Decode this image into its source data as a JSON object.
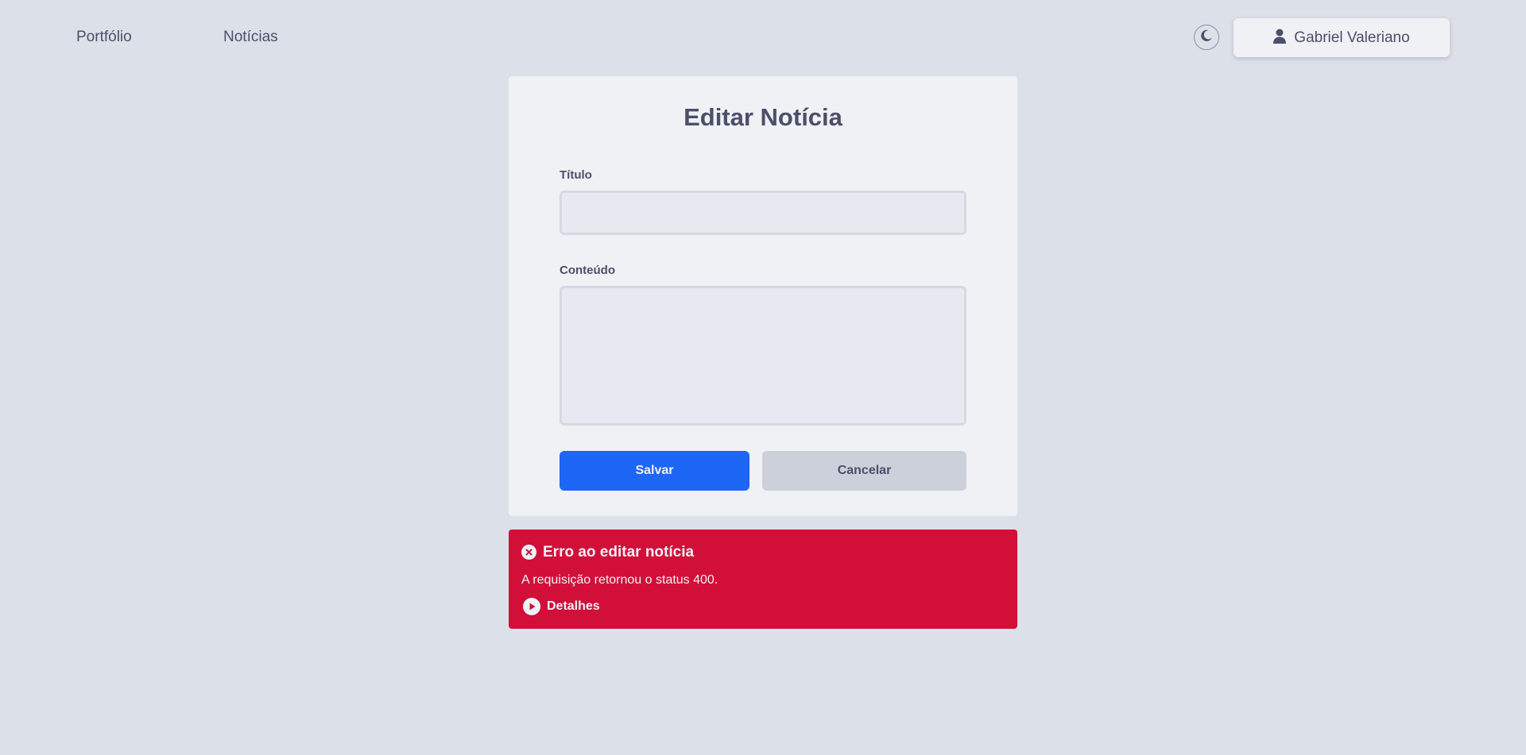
{
  "nav": {
    "links": [
      {
        "label": "Portfólio"
      },
      {
        "label": "Notícias"
      }
    ],
    "theme_toggle_icon": "moon-icon",
    "user": {
      "icon": "user-icon",
      "name": "Gabriel Valeriano"
    }
  },
  "form": {
    "title": "Editar Notícia",
    "fields": {
      "titulo": {
        "label": "Título",
        "value": "",
        "placeholder": ""
      },
      "conteudo": {
        "label": "Conteúdo",
        "value": "",
        "placeholder": ""
      }
    },
    "buttons": {
      "save_label": "Salvar",
      "cancel_label": "Cancelar"
    }
  },
  "alert": {
    "icon": "error-x-icon",
    "title": "Erro ao editar notícia",
    "message": "A requisição retornou o status 400.",
    "details_icon": "play-circle-icon",
    "details_label": "Detalhes"
  },
  "colors": {
    "background": "#dce0e8",
    "surface": "#eff1f5",
    "text": "#4c4f69",
    "primary": "#1e66f5",
    "secondary": "#ccd0da",
    "error": "#d20f39"
  }
}
